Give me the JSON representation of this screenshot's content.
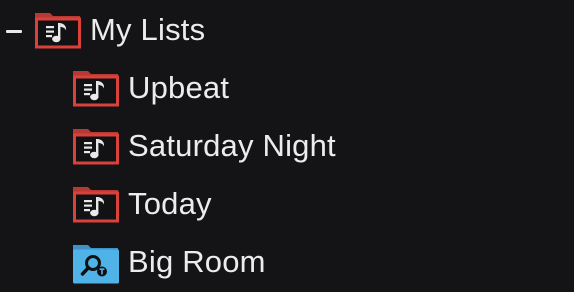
{
  "tree": {
    "root": {
      "label": "My Lists",
      "expanded": true,
      "icon": "playlist-folder-icon",
      "icon_color": "#d9413a"
    },
    "children": [
      {
        "label": "Upbeat",
        "icon": "playlist-folder-icon",
        "icon_color": "#d9413a"
      },
      {
        "label": "Saturday Night",
        "icon": "playlist-folder-icon",
        "icon_color": "#d9413a"
      },
      {
        "label": "Today",
        "icon": "playlist-folder-icon",
        "icon_color": "#d9413a"
      },
      {
        "label": "Big Room",
        "icon": "smart-search-folder-icon",
        "icon_color": "#4fb3e8"
      }
    ]
  },
  "colors": {
    "background": "#141416",
    "text": "#ececec",
    "playlist_red": "#d9413a",
    "smart_blue": "#4fb3e8"
  }
}
